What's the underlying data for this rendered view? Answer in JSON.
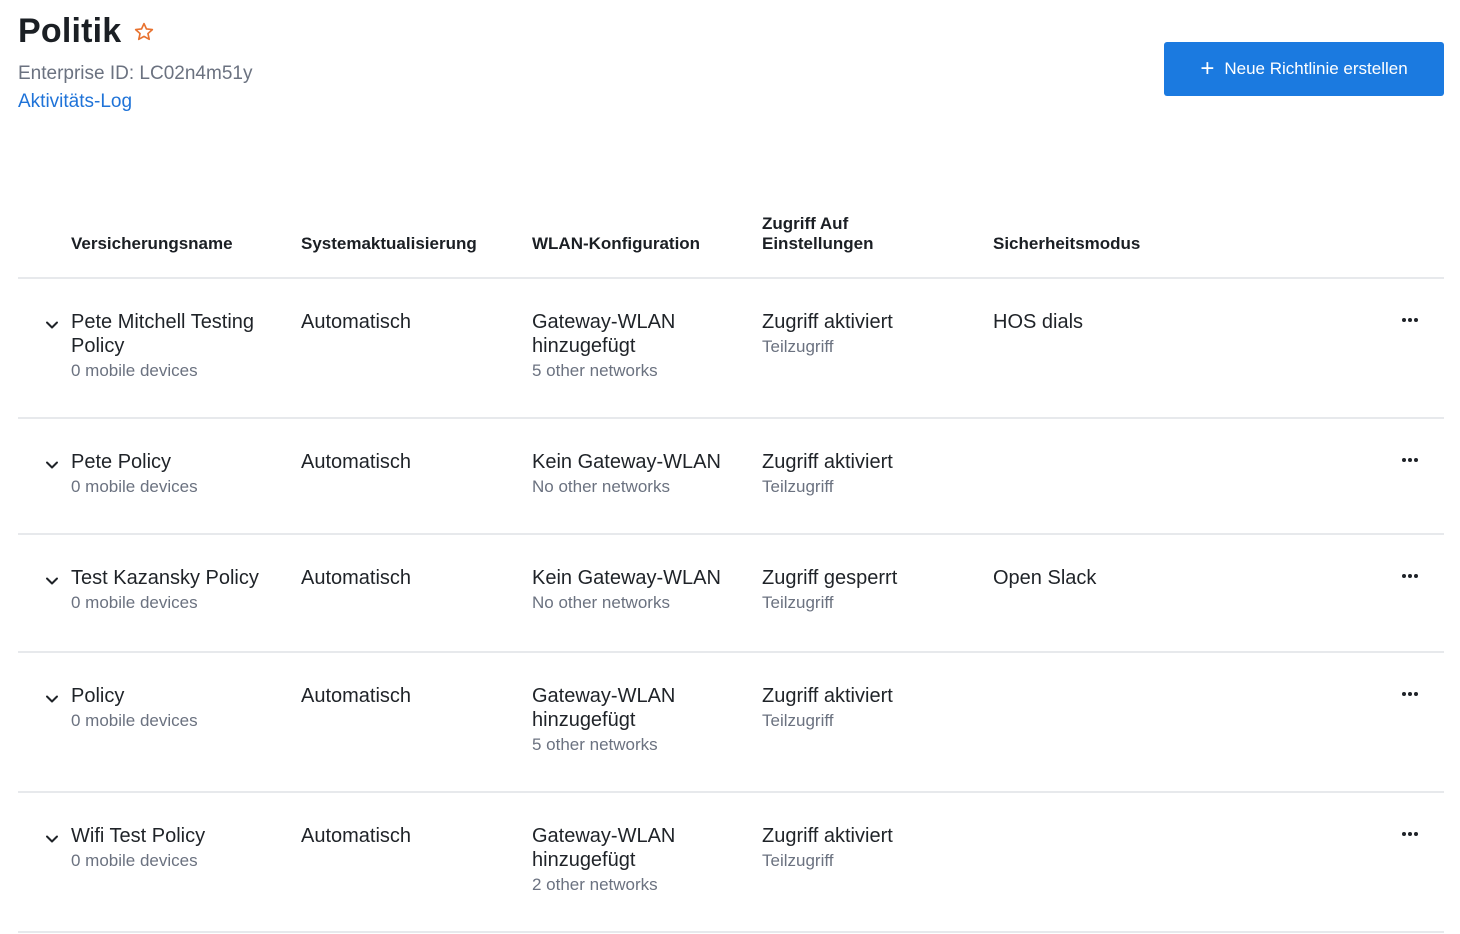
{
  "header": {
    "title": "Politik",
    "enterprise_id": "Enterprise ID: LC02n4m51y",
    "activity_link": "Aktivitäts-Log",
    "new_button_label": "Neue Richtlinie erstellen"
  },
  "colors": {
    "accent": "#1b7ae0",
    "link": "#1f73d8",
    "star": "#e8722f",
    "muted_text": "#6b7280",
    "divider": "#e7e9ec"
  },
  "table": {
    "columns": [
      "Versicherungsname",
      "Systemaktualisierung",
      "WLAN-Konfiguration",
      "Zugriff Auf Einstellungen",
      "Sicherheitsmodus"
    ],
    "rows": [
      {
        "name": "Pete Mitchell Testing Policy",
        "devices": "0 mobile devices",
        "system_update": "Automatisch",
        "wlan": "Gateway-WLAN hinzugefügt",
        "wlan_sub": "5 other networks",
        "access": "Zugriff aktiviert",
        "access_sub": "Teilzugriff",
        "security": "HOS dials"
      },
      {
        "name": "Pete Policy",
        "devices": "0 mobile devices",
        "system_update": "Automatisch",
        "wlan": "Kein Gateway-WLAN",
        "wlan_sub": "No other networks",
        "access": "Zugriff aktiviert",
        "access_sub": "Teilzugriff",
        "security": ""
      },
      {
        "name": "Test Kazansky Policy",
        "devices": "0 mobile devices",
        "system_update": "Automatisch",
        "wlan": "Kein Gateway-WLAN",
        "wlan_sub": "No other networks",
        "access": "Zugriff gesperrt",
        "access_sub": "Teilzugriff",
        "security": "Open Slack"
      },
      {
        "name": "Policy",
        "devices": "0 mobile devices",
        "system_update": "Automatisch",
        "wlan": "Gateway-WLAN hinzugefügt",
        "wlan_sub": "5 other networks",
        "access": "Zugriff aktiviert",
        "access_sub": "Teilzugriff",
        "security": ""
      },
      {
        "name": "Wifi Test Policy",
        "devices": "0 mobile devices",
        "system_update": "Automatisch",
        "wlan": "Gateway-WLAN hinzugefügt",
        "wlan_sub": "2 other networks",
        "access": "Zugriff aktiviert",
        "access_sub": "Teilzugriff",
        "security": ""
      }
    ]
  }
}
